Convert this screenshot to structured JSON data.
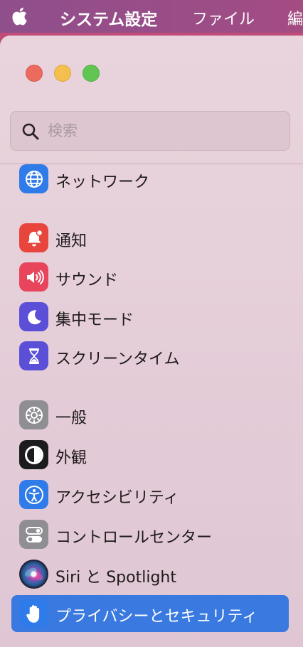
{
  "menubar": {
    "app_name": "システム設定",
    "file_menu": "ファイル",
    "edit_menu": "編"
  },
  "search": {
    "placeholder": "検索"
  },
  "sidebar": {
    "items": [
      {
        "label": "ネットワーク",
        "icon": "globe-icon",
        "color": "#2f7be9"
      },
      {
        "label": "通知",
        "icon": "bell-icon",
        "color": "#e8453c"
      },
      {
        "label": "サウンド",
        "icon": "speaker-icon",
        "color": "#e8455c"
      },
      {
        "label": "集中モード",
        "icon": "moon-icon",
        "color": "#5a4fd6"
      },
      {
        "label": "スクリーンタイム",
        "icon": "hourglass-icon",
        "color": "#5a4fd6"
      },
      {
        "label": "一般",
        "icon": "gear-icon",
        "color": "#8e8e93"
      },
      {
        "label": "外観",
        "icon": "appearance-icon",
        "color": "#1c1c1e"
      },
      {
        "label": "アクセシビリティ",
        "icon": "accessibility-icon",
        "color": "#2f7be9"
      },
      {
        "label": "コントロールセンター",
        "icon": "toggles-icon",
        "color": "#8e8e93"
      },
      {
        "label": "Siri と Spotlight",
        "icon": "siri-icon",
        "color": "#2b2240"
      },
      {
        "label": "プライバシーとセキュリティ",
        "icon": "hand-icon",
        "color": "#2f7be9",
        "selected": true
      }
    ]
  }
}
